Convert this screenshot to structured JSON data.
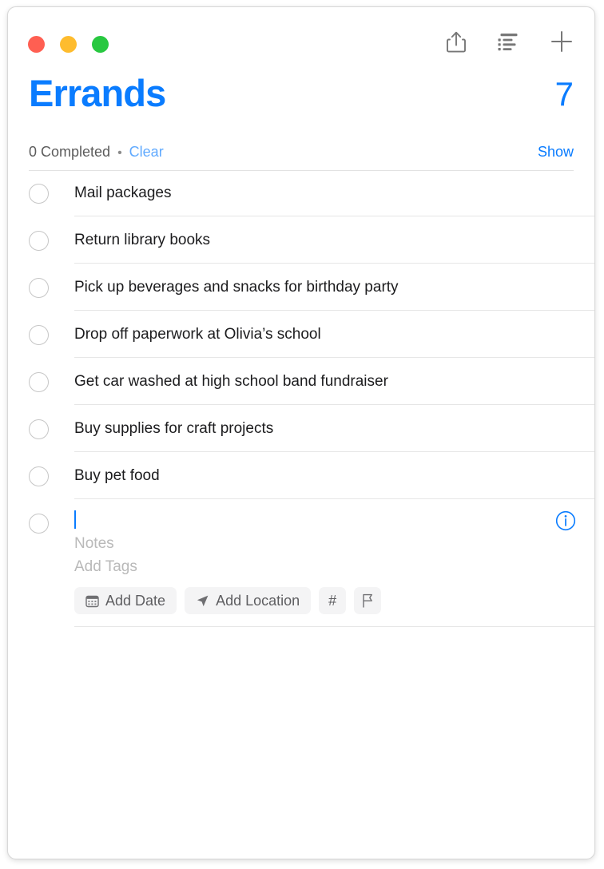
{
  "window": {
    "traffic_lights": [
      {
        "name": "close",
        "color": "#ff5f52"
      },
      {
        "name": "minimize",
        "color": "#febc2e"
      },
      {
        "name": "zoom",
        "color": "#28c840"
      }
    ]
  },
  "toolbar": {
    "share_label": "share-icon",
    "view_options_label": "list-view-icon",
    "add_label": "plus-icon"
  },
  "header": {
    "title": "Errands",
    "count": "7",
    "accent_color": "#0a7cff"
  },
  "completed_bar": {
    "completed_text": "0 Completed",
    "separator": "•",
    "clear_label": "Clear",
    "show_label": "Show",
    "clear_color": "#60aaff",
    "show_color": "#0a7cff"
  },
  "reminders": [
    {
      "text": "Mail packages",
      "completed": false
    },
    {
      "text": "Return library books",
      "completed": false
    },
    {
      "text": "Pick up beverages and snacks for birthday party",
      "completed": false
    },
    {
      "text": "Drop off paperwork at Olivia’s school",
      "completed": false
    },
    {
      "text": "Get car washed at high school band fundraiser",
      "completed": false
    },
    {
      "text": "Buy supplies for craft projects",
      "completed": false
    },
    {
      "text": "Buy pet food",
      "completed": false
    }
  ],
  "new_reminder": {
    "title_value": "",
    "notes_placeholder": "Notes",
    "tags_placeholder": "Add Tags",
    "chips": [
      {
        "label": "Add Date",
        "icon": "calendar-icon"
      },
      {
        "label": "Add Location",
        "icon": "location-arrow-icon"
      },
      {
        "label": "#",
        "icon": "hash-icon"
      },
      {
        "label": "",
        "icon": "flag-icon"
      }
    ],
    "info_label": "info-icon"
  }
}
